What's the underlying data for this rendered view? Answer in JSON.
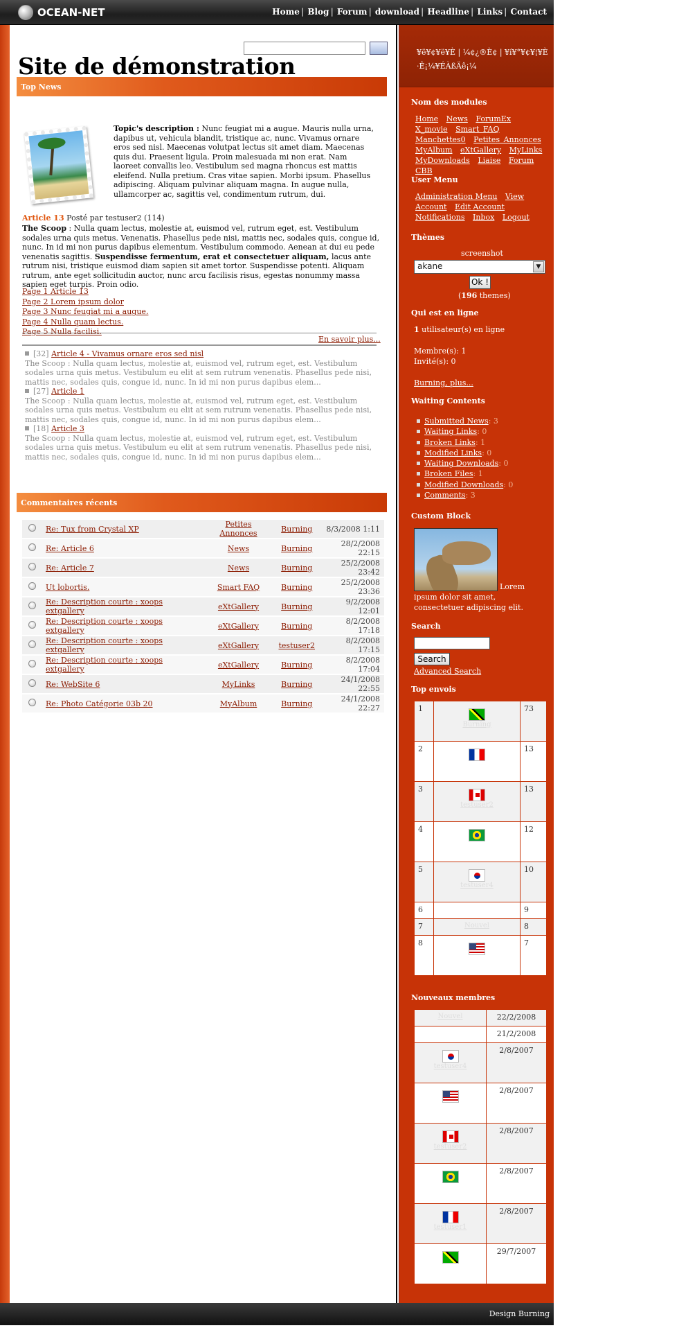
{
  "header": {
    "logo_text": "OCEAN-NET",
    "nav": [
      "Home",
      "Blog",
      "Forum",
      "download",
      "Headline",
      "Links",
      "Contact"
    ],
    "search_button": " "
  },
  "main": {
    "site_title": "Site de démonstration",
    "top_news_title": "Top News",
    "topic_label": "Topic's description :",
    "topic_text": "Nunc feugiat mi a augue. Mauris nulla urna, dapibus ut, vehicula blandit, tristique ac, nunc. Vivamus ornare eros sed nisl. Maecenas volutpat lectus sit amet diam. Maecenas quis dui. Praesent ligula. Proin malesuada mi non erat. Nam laoreet convallis leo. Vestibulum sed magna rhoncus est mattis eleifend. Nulla pretium. Cras vitae sapien. Morbi ipsum. Phasellus adipiscing. Aliquam pulvinar aliquam magna. In augue nulla, ullamcorper ac, sagittis vel, condimentum rutrum, dui.",
    "article_title": "Article 13",
    "article_meta": "Posté par testuser2 (114)",
    "scoop_label": "The Scoop",
    "scoop_text_1": ": Nulla quam lectus, molestie at, euismod vel, rutrum eget, est. Vestibulum sodales urna quis metus. Venenatis. Phasellus pede nisi, mattis nec, sodales quis, congue id, nunc. In id mi non purus dapibus elementum. Vestibulum commodo. Aenean at dui eu pede venenatis sagittis.",
    "scoop_bold": "Suspendisse fermentum, erat et consectetuer aliquam,",
    "scoop_text_2": "lacus ante rutrum nisi, tristique euismod diam sapien sit amet tortor. Suspendisse potenti. Aliquam rutrum, ante eget sollicitudin auctor, nunc arcu facilisis risus, egestas nonummy massa sapien eget turpis. Proin odio.",
    "pages": [
      "Page 1 Article 13",
      "Page 2 Lorem ipsum dolor",
      "Page 3 Nunc feugiat mi a augue.",
      "Page 4 Nulla quam lectus.",
      "Page 5 Nulla facilisi."
    ],
    "read_more": "En savoir plus...",
    "news_items": [
      {
        "count": "[32]",
        "title": "Article 4 - Vivamus ornare eros sed nisl",
        "summary": "The Scoop : Nulla quam lectus, molestie at, euismod vel, rutrum eget, est. Vestibulum sodales urna quis metus. Vestibulum eu elit at sem rutrum venenatis. Phasellus pede nisi, mattis nec, sodales quis, congue id, nunc. In id mi non purus dapibus elem..."
      },
      {
        "count": "[27]",
        "title": "Article 1",
        "summary": "The Scoop : Nulla quam lectus, molestie at, euismod vel, rutrum eget, est. Vestibulum sodales urna quis metus. Vestibulum eu elit at sem rutrum venenatis. Phasellus pede nisi, mattis nec, sodales quis, congue id, nunc. In id mi non purus dapibus elem..."
      },
      {
        "count": "[18]",
        "title": "Article 3",
        "summary": "The Scoop : Nulla quam lectus, molestie at, euismod vel, rutrum eget, est. Vestibulum sodales urna quis metus. Vestibulum eu elit at sem rutrum venenatis. Phasellus pede nisi, mattis nec, sodales quis, congue id, nunc. In id mi non purus dapibus elem..."
      }
    ],
    "comments_title": "Commentaires récents",
    "comments": [
      {
        "title": "Re: Tux from Crystal XP",
        "module": "Petites Annonces",
        "user": "Burning",
        "date": "8/3/2008 1:11"
      },
      {
        "title": "Re: Article 6",
        "module": "News",
        "user": "Burning",
        "date": "28/2/2008 22:15"
      },
      {
        "title": "Re: Article 7",
        "module": "News",
        "user": "Burning",
        "date": "25/2/2008 23:42"
      },
      {
        "title": "Ut lobortis.",
        "module": "Smart FAQ",
        "user": "Burning",
        "date": "25/2/2008 23:36"
      },
      {
        "title": "Re: Description courte : xoops extgallery",
        "module": "eXtGallery",
        "user": "Burning",
        "date": "9/2/2008 12:01"
      },
      {
        "title": "Re: Description courte : xoops extgallery",
        "module": "eXtGallery",
        "user": "Burning",
        "date": "8/2/2008 17:18"
      },
      {
        "title": "Re: Description courte : xoops extgallery",
        "module": "eXtGallery",
        "user": "testuser2",
        "date": "8/2/2008 17:15"
      },
      {
        "title": "Re: Description courte : xoops extgallery",
        "module": "eXtGallery",
        "user": "Burning",
        "date": "8/2/2008 17:04"
      },
      {
        "title": "Re: WebSite 6",
        "module": "MyLinks",
        "user": "Burning",
        "date": "24/1/2008 22:55"
      },
      {
        "title": "Re: Photo Catégorie 03b 20",
        "module": "MyAlbum",
        "user": "Burning",
        "date": "24/1/2008 22:27"
      }
    ]
  },
  "sidebar": {
    "garbled_line1": "¥ë¥¢¥ë¥È | ¼¢¿®È¢ | ¥í¥°¥¢¥¦¥È",
    "garbled_line2": "·Ê¡¼¥ÉÀßÄê¡¼",
    "modules_title": "Nom des modules",
    "modules": [
      "Home",
      "News",
      "ForumEx",
      "X_movie",
      "Smart FAQ",
      "Manchettes0",
      "Petites Annonces",
      "MyAlbum",
      "eXtGallery",
      "MyLinks",
      "MyDownloads",
      "Liaise",
      "Forum CBB"
    ],
    "user_menu_title": "User Menu",
    "user_menu": [
      "Administration Menu",
      "View Account",
      "Edit Account",
      "Notifications",
      "Inbox",
      "Logout"
    ],
    "themes_title": "Thèmes",
    "themes_screenshot": "screenshot",
    "theme_selected": "akane",
    "theme_ok": "Ok !",
    "themes_count_open": "(",
    "themes_count": "196",
    "themes_count_close": " themes)",
    "online_title": "Qui est en ligne",
    "online_count": "1",
    "online_text": " utilisateur(s) en ligne",
    "members": "Membre(s): 1",
    "guests": "Invité(s): 0",
    "online_link": "Burning, plus...",
    "waiting_title": "Waiting Contents",
    "waiting": [
      {
        "label": "Submitted News",
        "count": ": 3"
      },
      {
        "label": "Waiting Links",
        "count": ": 0"
      },
      {
        "label": "Broken Links",
        "count": ": 1"
      },
      {
        "label": "Modified Links",
        "count": ": 0"
      },
      {
        "label": "Waiting Downloads",
        "count": ": 0"
      },
      {
        "label": "Broken Files",
        "count": ": 1"
      },
      {
        "label": "Modified Downloads",
        "count": ": 0"
      },
      {
        "label": "Comments",
        "count": ": 3"
      }
    ],
    "custom_title": "Custom Block",
    "custom_text": "Lorem ipsum dolor sit amet, consectetuer adipiscing elit.",
    "search_title": "Search",
    "search_button": "Search",
    "advanced_search": "Advanced Search",
    "top_title": "Top envois",
    "top": [
      {
        "rank": "1",
        "flag": "jm",
        "user": "Burning",
        "count": "73"
      },
      {
        "rank": "2",
        "flag": "fr",
        "user": "",
        "count": "13"
      },
      {
        "rank": "3",
        "flag": "ca",
        "user": "testuser2",
        "count": "13"
      },
      {
        "rank": "4",
        "flag": "br",
        "user": "",
        "count": "12"
      },
      {
        "rank": "5",
        "flag": "kr",
        "user": "testuser4",
        "count": "10"
      },
      {
        "rank": "6",
        "flag": "",
        "user": "",
        "count": "9"
      },
      {
        "rank": "7",
        "flag": "",
        "user": "Nouvel",
        "count": "8"
      },
      {
        "rank": "8",
        "flag": "us",
        "user": "",
        "count": "7"
      }
    ],
    "new_title": "Nouveaux membres",
    "new_members": [
      {
        "flag": "",
        "user": "Nouvel",
        "date": "22/2/2008"
      },
      {
        "flag": "",
        "user": "",
        "date": "21/2/2008"
      },
      {
        "flag": "kr",
        "user": "testuser4",
        "date": "2/8/2007"
      },
      {
        "flag": "us",
        "user": "",
        "date": "2/8/2007"
      },
      {
        "flag": "ca",
        "user": "testuser2",
        "date": "2/8/2007"
      },
      {
        "flag": "br",
        "user": "",
        "date": "2/8/2007"
      },
      {
        "flag": "fr",
        "user": "testuser1",
        "date": "2/8/2007"
      },
      {
        "flag": "jm",
        "user": "",
        "date": "29/7/2007"
      }
    ]
  },
  "footer": {
    "credit": "Design Burning"
  }
}
